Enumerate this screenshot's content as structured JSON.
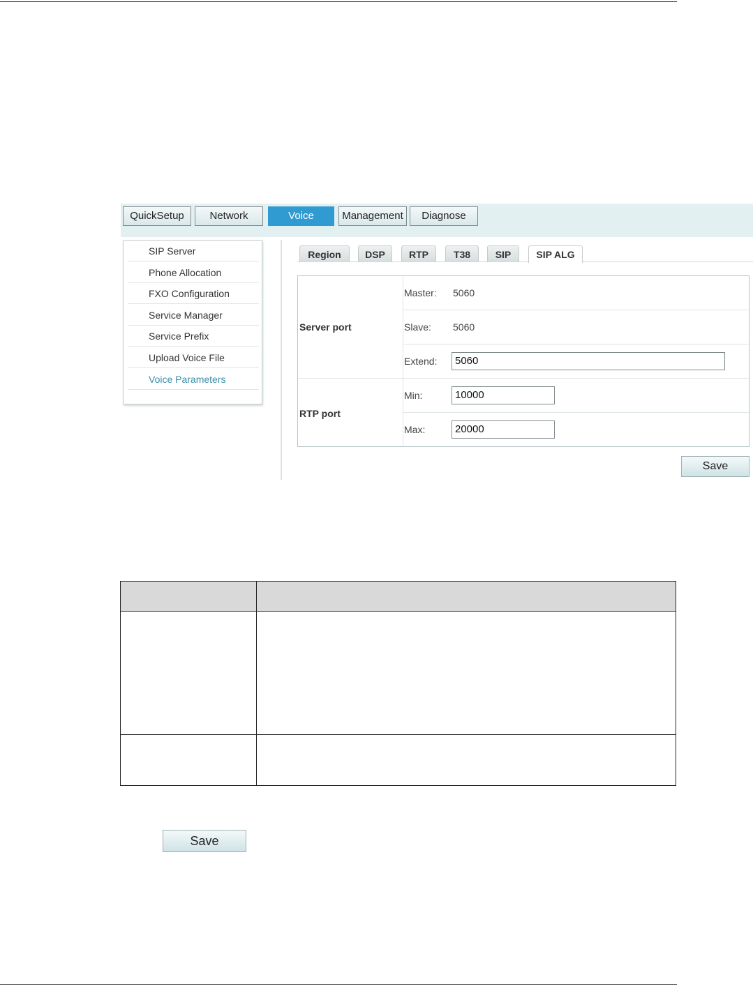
{
  "nav": {
    "tabs": [
      {
        "label": "QuickSetup"
      },
      {
        "label": "Network"
      },
      {
        "label": "Voice"
      },
      {
        "label": "Management"
      },
      {
        "label": "Diagnose"
      }
    ],
    "active": "Voice"
  },
  "sidebar": {
    "items": [
      {
        "label": "SIP Server"
      },
      {
        "label": "Phone Allocation"
      },
      {
        "label": "FXO Configuration"
      },
      {
        "label": "Service Manager"
      },
      {
        "label": "Service Prefix"
      },
      {
        "label": "Upload Voice File"
      },
      {
        "label": "Voice Parameters"
      }
    ],
    "active": "Voice Parameters"
  },
  "subtabs": {
    "items": [
      {
        "label": "Region"
      },
      {
        "label": "DSP"
      },
      {
        "label": "RTP"
      },
      {
        "label": "T38"
      },
      {
        "label": "SIP"
      },
      {
        "label": "SIP ALG"
      }
    ],
    "active": "SIP ALG"
  },
  "form": {
    "server_port": {
      "label": "Server port",
      "master_label": "Master:",
      "master_value": "5060",
      "slave_label": "Slave:",
      "slave_value": "5060",
      "extend_label": "Extend:",
      "extend_value": "5060"
    },
    "rtp_port": {
      "label": "RTP port",
      "min_label": "Min:",
      "min_value": "10000",
      "max_label": "Max:",
      "max_value": "20000"
    },
    "save_label": "Save"
  },
  "doc": {
    "save_label": "Save"
  },
  "colors": {
    "nav_active": "#2f9bd1",
    "sidebar_active": "#3b8ea8",
    "navbar_bg": "#e3f0f2"
  }
}
